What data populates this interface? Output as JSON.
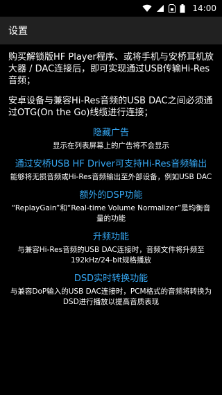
{
  "status_bar": {
    "time": "14:00",
    "icons": [
      "wifi-icon",
      "signal-icon",
      "sim-icon",
      "battery-icon"
    ]
  },
  "app_bar": {
    "title": "设置"
  },
  "intro": [
    "购买解锁版HF Player程序、或将手机与安桥耳机放大器 / DAC连接后，即可实现通过USB传输Hi-Res音频；",
    "安卓设备与兼容Hi-Res音频的USB DAC之间必须通过OTG(On the Go)线缆进行连接；"
  ],
  "features": [
    {
      "title": "隐藏广告",
      "desc": "显示在列表屏幕上的广告将不会显示"
    },
    {
      "title": "通过安桥USB HF Driver可支持Hi-Res音频输出",
      "desc": "能够将无损音频或Hi-Res音频输出至外部设备，例如USB DAC"
    },
    {
      "title": "额外的DSP功能",
      "desc": "“ReplayGain”和“Real-time Volume Normalizer”是均衡音量的功能"
    },
    {
      "title": "升频功能",
      "desc": "与兼容Hi-Res音频的USB DAC连接时，音频文件将升频至192kHz/24-bit规格播放"
    },
    {
      "title": "DSD实时转换功能",
      "desc": "与兼容DoP输入的USB DAC连接时，PCM格式的音频将转换为DSD进行播放以提高音质表现"
    }
  ],
  "colors": {
    "accent": "#36a9f5",
    "app_bar": "#212121",
    "background": "#000000"
  }
}
